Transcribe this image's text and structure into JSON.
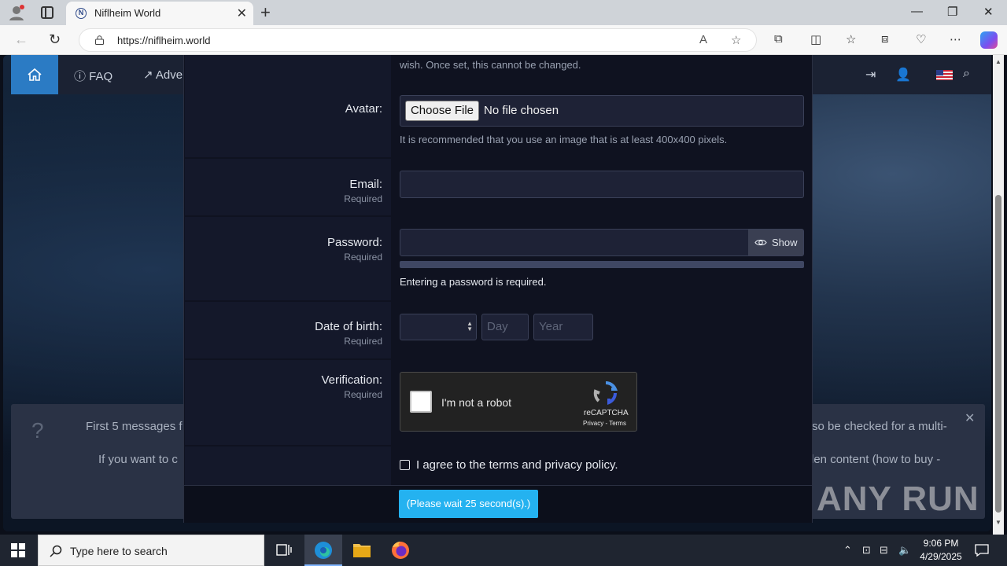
{
  "browser": {
    "tab_title": "Niflheim World",
    "tab_favicon_letter": "N",
    "url": "https://niflheim.world",
    "window_controls": [
      "—",
      "❐",
      "✕"
    ]
  },
  "site_nav": {
    "items": [
      "FAQ",
      "Adve"
    ]
  },
  "notice": {
    "line1_left": "First 5 messages f",
    "line1_right": "so be checked for a multi-",
    "line2_left": "If you want to c",
    "line2_right": "den content (how to buy -"
  },
  "form": {
    "top_hint": "wish. Once set, this cannot be changed.",
    "avatar_label": "Avatar:",
    "choose_file": "Choose File",
    "no_file": "No file chosen",
    "avatar_hint": "It is recommended that you use an image that is at least 400x400 pixels.",
    "email_label": "Email:",
    "required": "Required",
    "password_label": "Password:",
    "show_label": "Show",
    "password_hint": "Entering a password is required.",
    "dob_label": "Date of birth:",
    "day_placeholder": "Day",
    "year_placeholder": "Year",
    "verification_label": "Verification:",
    "captcha_text": "I'm not a robot",
    "captcha_brand": "reCAPTCHA",
    "captcha_links": "Privacy - Terms",
    "agree_text": "I agree to the terms and privacy policy.",
    "submit_label": "(Please wait 25 second(s).)"
  },
  "watermark": "ANY RUN",
  "taskbar": {
    "search_placeholder": "Type here to search",
    "time": "9:06 PM",
    "date": "4/29/2025"
  }
}
